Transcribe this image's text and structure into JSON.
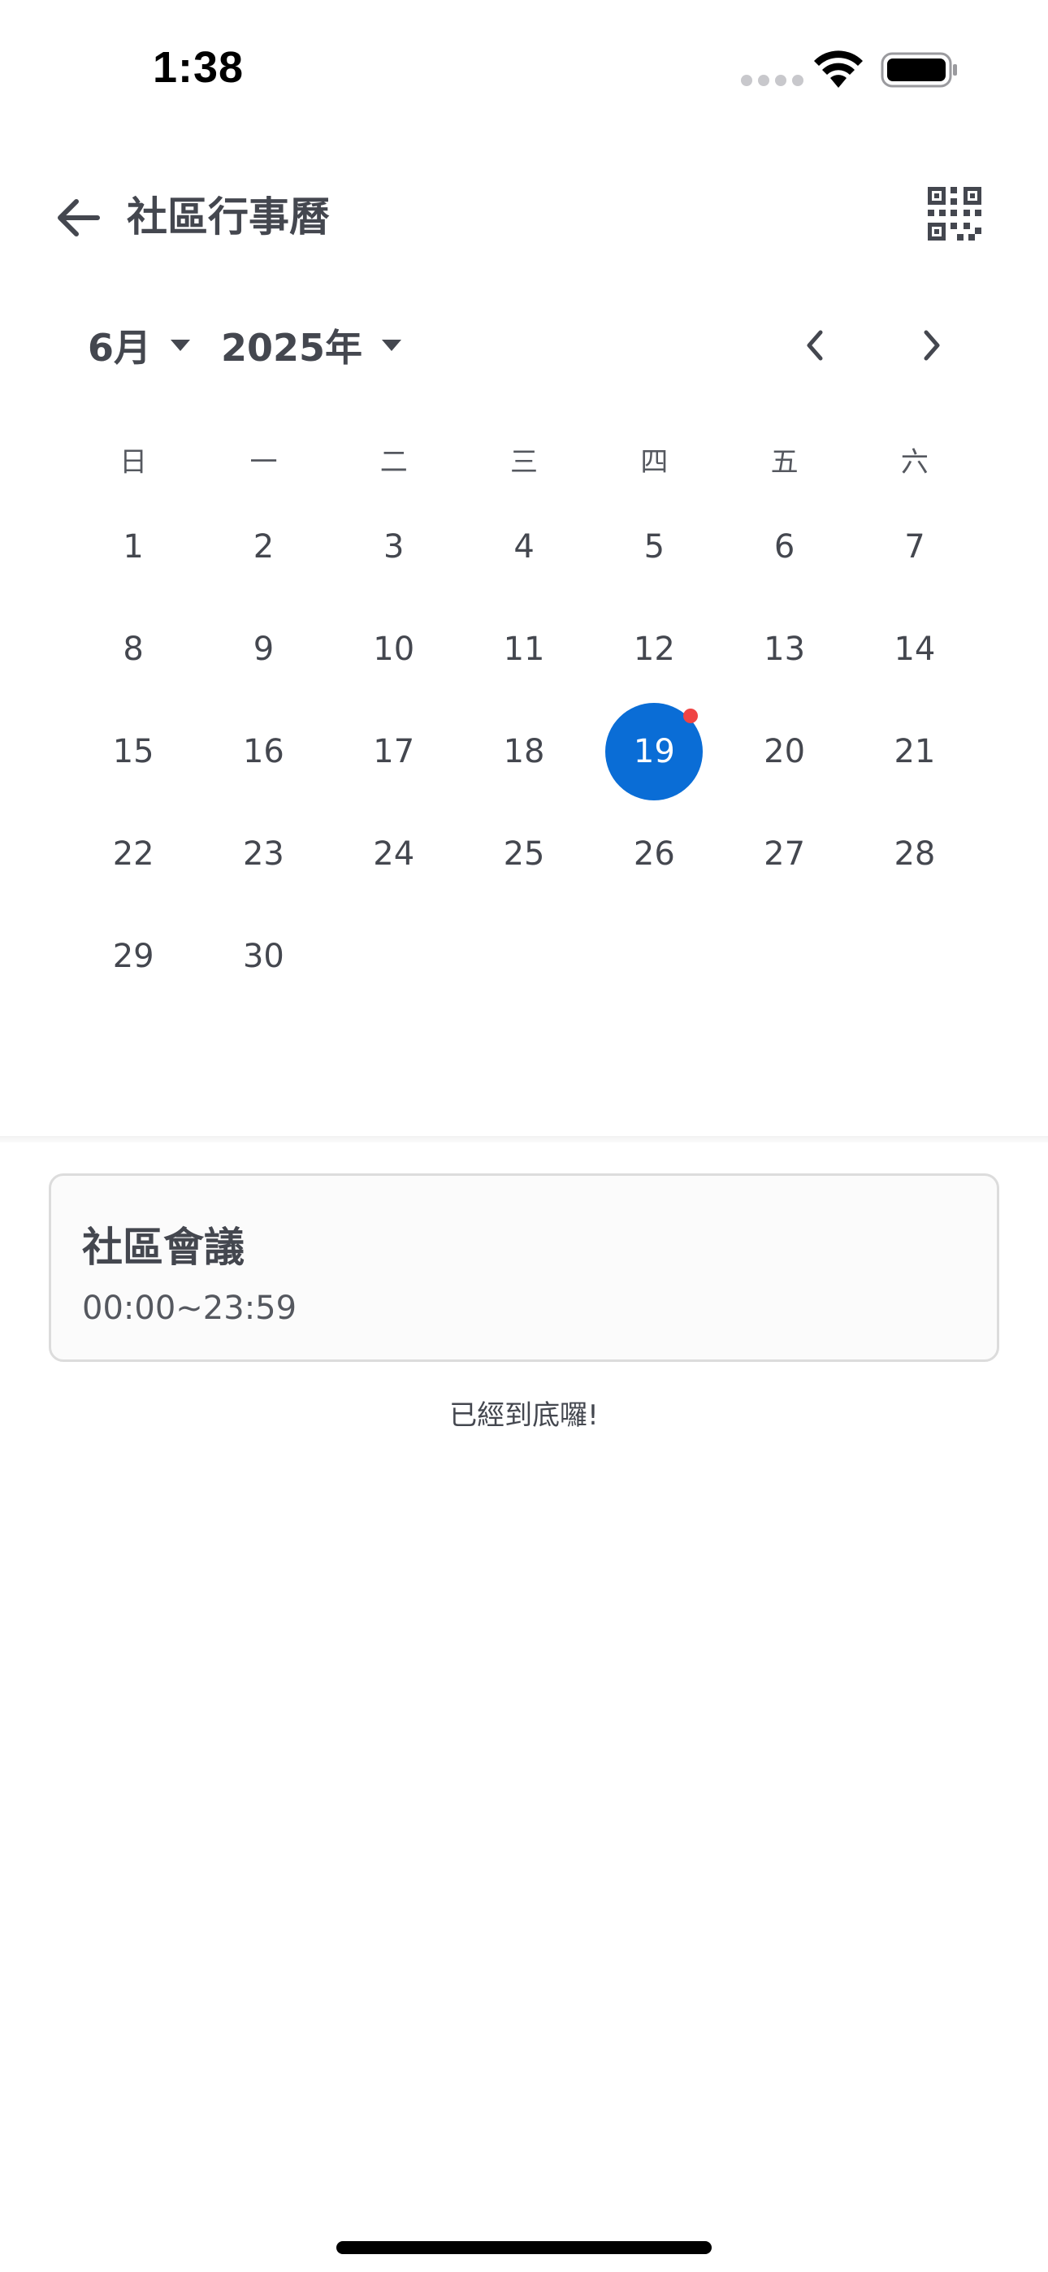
{
  "status_bar": {
    "time": "1:38"
  },
  "header": {
    "title": "社區行事曆",
    "back_icon": "arrow-left-icon",
    "action_icon": "qr-code-icon"
  },
  "selector": {
    "month": "6月",
    "year": "2025年"
  },
  "calendar": {
    "weekdays": [
      "日",
      "一",
      "二",
      "三",
      "四",
      "五",
      "六"
    ],
    "weeks": [
      [
        "1",
        "2",
        "3",
        "4",
        "5",
        "6",
        "7"
      ],
      [
        "8",
        "9",
        "10",
        "11",
        "12",
        "13",
        "14"
      ],
      [
        "15",
        "16",
        "17",
        "18",
        "19",
        "20",
        "21"
      ],
      [
        "22",
        "23",
        "24",
        "25",
        "26",
        "27",
        "28"
      ],
      [
        "29",
        "30",
        "",
        "",
        "",
        "",
        ""
      ]
    ],
    "selected_day": "19",
    "days_with_events": [
      "19"
    ]
  },
  "events": [
    {
      "title": "社區會議",
      "time": "00:00~23:59"
    }
  ],
  "end_message": "已經到底囉!",
  "colors": {
    "accent": "#0a6dd6",
    "event_dot": "#ef4444",
    "text": "#44474f"
  }
}
